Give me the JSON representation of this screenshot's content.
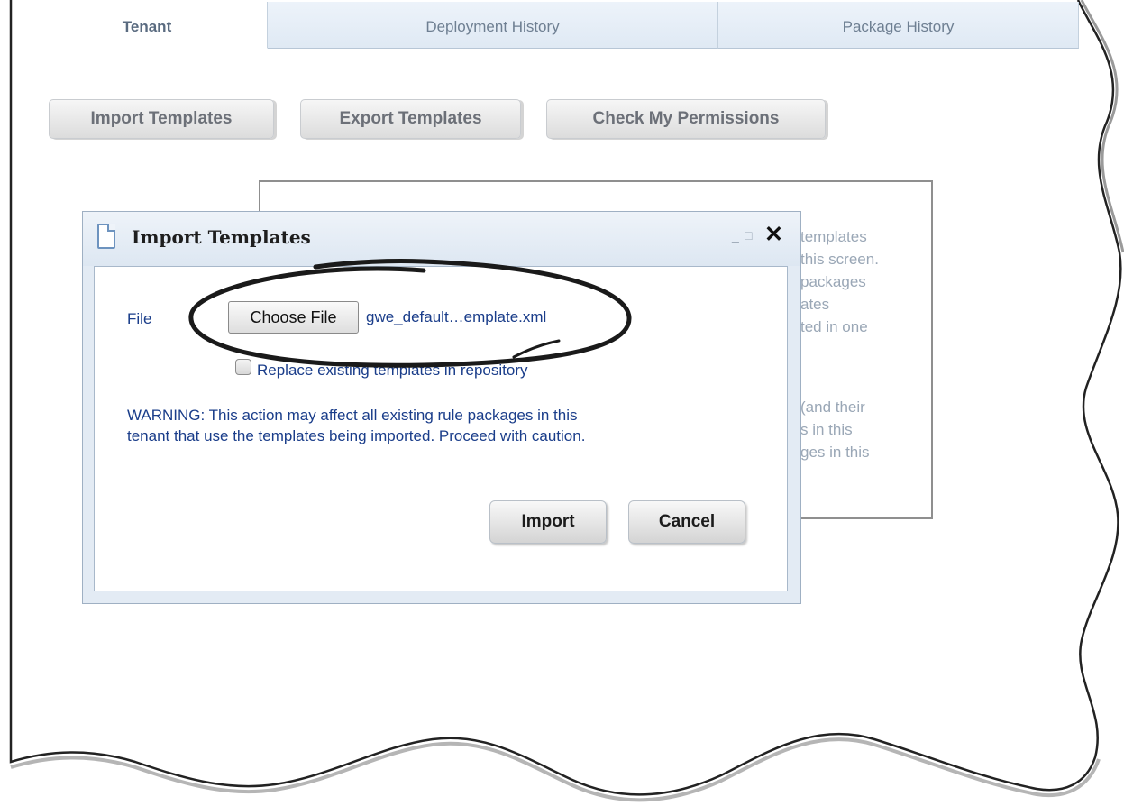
{
  "tabs": [
    {
      "label": "Tenant",
      "active": true
    },
    {
      "label": "Deployment History",
      "active": false
    },
    {
      "label": "Package History",
      "active": false
    }
  ],
  "toolbar": {
    "import_label": "Import Templates",
    "export_label": "Export Templates",
    "permissions_label": "Check My Permissions"
  },
  "background_panel": {
    "lines": [
      "templates",
      "this screen.",
      "packages",
      "ates",
      "ted in one",
      "(and their",
      "s in this",
      "ges in this"
    ]
  },
  "dialog": {
    "title": "Import Templates",
    "icon": "document-icon",
    "file_label": "File",
    "choose_file_label": "Choose File",
    "selected_file": "gwe_default…emplate.xml",
    "replace_checkbox_label": "Replace existing templates in repository",
    "replace_checked": false,
    "warning_line1": "WARNING: This action may affect all existing rule packages in this",
    "warning_line2": "tenant that use the templates being imported. Proceed with caution.",
    "import_label": "Import",
    "cancel_label": "Cancel"
  },
  "colors": {
    "link_text": "#1a3d8a",
    "tab_bg": "#dfe9f4",
    "panel_border": "#8f8f8f"
  }
}
